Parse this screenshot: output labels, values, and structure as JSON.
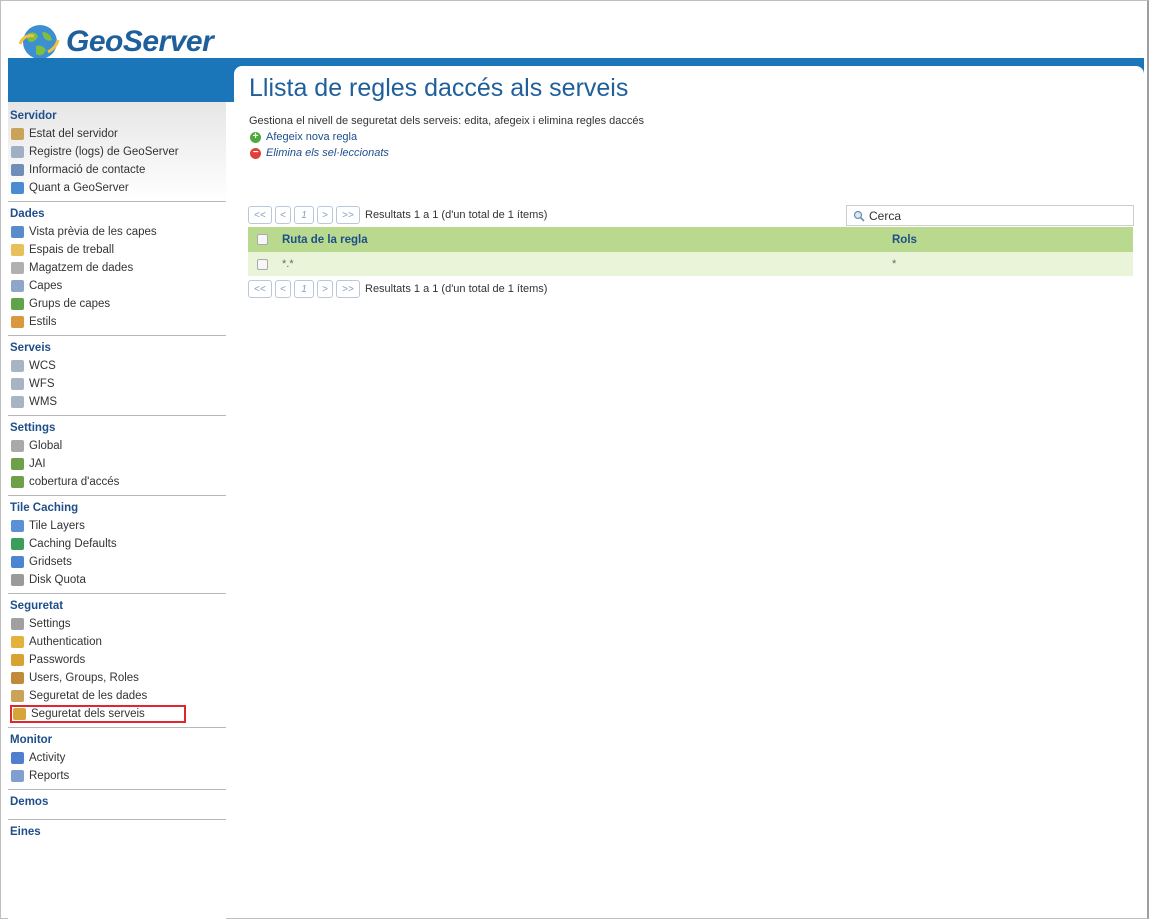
{
  "app": {
    "logo_text": "GeoServer"
  },
  "sidebar": {
    "sections": [
      {
        "title": "Servidor",
        "items": [
          {
            "label": "Estat del servidor",
            "icon": "server-status-icon"
          },
          {
            "label": "Registre (logs) de GeoServer",
            "icon": "logs-icon"
          },
          {
            "label": "Informació de contacte",
            "icon": "contact-icon"
          },
          {
            "label": "Quant a GeoServer",
            "icon": "about-icon"
          }
        ]
      },
      {
        "title": "Dades",
        "items": [
          {
            "label": "Vista prèvia de les capes",
            "icon": "layer-preview-icon"
          },
          {
            "label": "Espais de treball",
            "icon": "workspace-folder-icon"
          },
          {
            "label": "Magatzem de dades",
            "icon": "store-icon"
          },
          {
            "label": "Capes",
            "icon": "layers-icon"
          },
          {
            "label": "Grups de capes",
            "icon": "layer-groups-icon"
          },
          {
            "label": "Estils",
            "icon": "styles-icon"
          }
        ]
      },
      {
        "title": "Serveis",
        "items": [
          {
            "label": "WCS",
            "icon": "service-icon"
          },
          {
            "label": "WFS",
            "icon": "service-icon"
          },
          {
            "label": "WMS",
            "icon": "service-icon"
          }
        ]
      },
      {
        "title": "Settings",
        "items": [
          {
            "label": "Global",
            "icon": "global-settings-icon"
          },
          {
            "label": "JAI",
            "icon": "jai-icon"
          },
          {
            "label": "cobertura d'accés",
            "icon": "coverage-access-icon"
          }
        ]
      },
      {
        "title": "Tile Caching",
        "items": [
          {
            "label": "Tile Layers",
            "icon": "tile-layers-icon"
          },
          {
            "label": "Caching Defaults",
            "icon": "caching-defaults-icon"
          },
          {
            "label": "Gridsets",
            "icon": "gridsets-icon"
          },
          {
            "label": "Disk Quota",
            "icon": "disk-quota-icon"
          }
        ]
      },
      {
        "title": "Seguretat",
        "items": [
          {
            "label": "Settings",
            "icon": "wrench-icon"
          },
          {
            "label": "Authentication",
            "icon": "shield-icon"
          },
          {
            "label": "Passwords",
            "icon": "lock-icon"
          },
          {
            "label": "Users, Groups, Roles",
            "icon": "users-icon"
          },
          {
            "label": "Seguretat de les dades",
            "icon": "data-security-icon"
          },
          {
            "label": "Seguretat dels serveis",
            "icon": "service-security-icon",
            "highlighted": true
          }
        ]
      },
      {
        "title": "Monitor",
        "items": [
          {
            "label": "Activity",
            "icon": "activity-chart-icon"
          },
          {
            "label": "Reports",
            "icon": "reports-icon"
          }
        ]
      },
      {
        "title": "Demos",
        "items": []
      },
      {
        "title": "Eines",
        "items": []
      }
    ]
  },
  "main": {
    "title": "Llista de regles daccés als serveis",
    "description": "Gestiona el nivell de seguretat dels serveis: edita, afegeix i elimina regles daccés",
    "add_label": "Afegeix nova regla",
    "remove_label": "Elimina els sel·leccionats",
    "pager": {
      "first": "<<",
      "prev": "<",
      "page": "1",
      "next": ">",
      "last": ">>",
      "info": "Resultats 1 a 1 (d'un total de 1 ítems)"
    },
    "search": {
      "placeholder": "Cerca",
      "value": "Cerca"
    },
    "table": {
      "columns": [
        "Ruta de la regla",
        "Rols"
      ],
      "rows": [
        [
          "*.*",
          "*"
        ]
      ]
    }
  },
  "colors": {
    "brand_blue": "#1a75b9",
    "table_header": "#b9d98e",
    "table_row": "#eaf4d9",
    "highlight_border": "#e0262e"
  }
}
